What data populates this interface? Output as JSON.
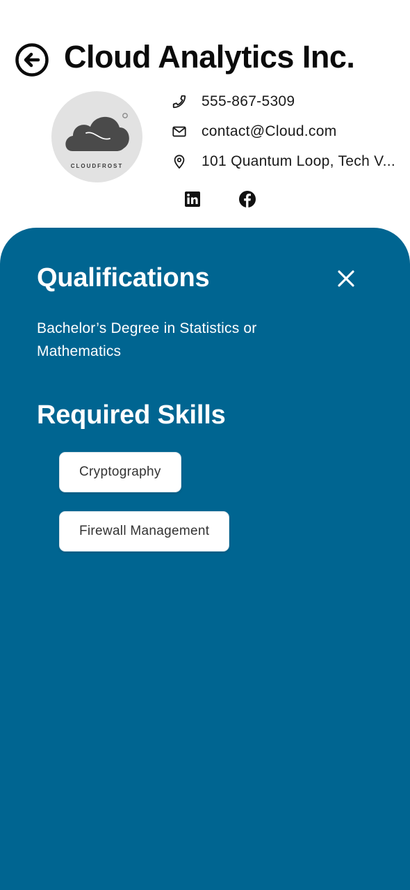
{
  "header": {
    "company_name": "Cloud Analytics Inc.",
    "back_icon": "arrow-left-circle-icon",
    "logo_text": "CLOUDFROST"
  },
  "contact": {
    "phone": "555-867-5309",
    "email": "contact@Cloud.com",
    "address": "101 Quantum Loop, Tech V..."
  },
  "social": {
    "linkedin_icon": "linkedin-icon",
    "facebook_icon": "facebook-icon"
  },
  "sheet": {
    "background": "#006591",
    "qualifications_title": "Qualifications",
    "qualifications_text": "Bachelor’s Degree in Statistics or Mathematics",
    "skills_title": "Required Skills",
    "skills": [
      "Cryptography",
      "Firewall Management"
    ],
    "close_icon": "close-icon"
  }
}
